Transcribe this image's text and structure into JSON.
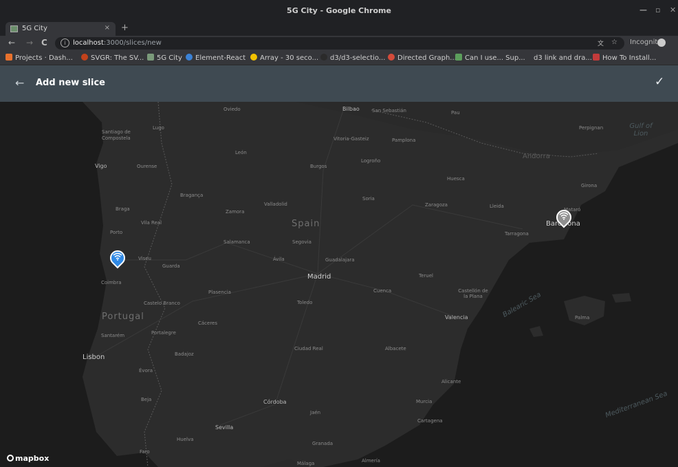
{
  "window": {
    "title": "5G City - Google Chrome"
  },
  "tab": {
    "label": "5G City",
    "close": "×",
    "new": "+"
  },
  "toolbar": {
    "url_host": "localhost",
    "url_path": ":3000/slices/new",
    "incognito": "Incognito",
    "back": "←",
    "forward": "→",
    "reload": "C"
  },
  "bookmarks": [
    {
      "label": "Projects · Dash...",
      "color": "#e8712d"
    },
    {
      "label": "SVGR: The SV...",
      "color": "#c2421b"
    },
    {
      "label": "5G City",
      "color": "#7a9a7a"
    },
    {
      "label": "Element-React",
      "color": "#3b82d6"
    },
    {
      "label": "Array - 30 seco...",
      "color": "#f2c200"
    },
    {
      "label": "d3/d3-selectio...",
      "color": "#2b2b2b"
    },
    {
      "label": "Directed Graph...",
      "color": "#d44b3a"
    },
    {
      "label": "Can I use... Sup...",
      "color": "#5c9e5c"
    },
    {
      "label": "d3 link and dra...",
      "color": "#888888"
    },
    {
      "label": "How To Install...",
      "color": "#c23b3b"
    }
  ],
  "appbar": {
    "back": "←",
    "title": "Add new slice",
    "confirm": "✓"
  },
  "map": {
    "country_labels": [
      "Spain",
      "Portugal"
    ],
    "sea_labels": [
      "Balearic Sea",
      "Mediterranean Sea",
      "Gulf of Lion"
    ],
    "cities": [
      "Oviedo",
      "Bilbao",
      "San Sebastián",
      "Pau",
      "Santiago de Compostela",
      "Lugo",
      "Vitoria-Gasteiz",
      "Pamplona",
      "Perpignan",
      "León",
      "Andorra",
      "Logroño",
      "Vigo",
      "Ourense",
      "Burgos",
      "Huesca",
      "Girona",
      "Bragança",
      "Soria",
      "Braga",
      "Valladolid",
      "Zaragoza",
      "Lleida",
      "Zamora",
      "Mataró",
      "Vila Real",
      "Barcelona",
      "Porto",
      "Tarragona",
      "Salamanca",
      "Segovia",
      "Viseu",
      "Ávila",
      "Guadalajara",
      "Guarda",
      "Madrid",
      "Teruel",
      "Coimbra",
      "Plasencia",
      "Cuenca",
      "Castellón de la Plana",
      "Toledo",
      "Castelo Branco",
      "Valencia",
      "Palma",
      "Cáceres",
      "Santarém",
      "Portalegre",
      "Badajoz",
      "Ciudad Real",
      "Albacete",
      "Lisbon",
      "Évora",
      "Alicante",
      "Beja",
      "Córdoba",
      "Murcia",
      "Jaén",
      "Cartagena",
      "Sevilla",
      "Granada",
      "Huelva",
      "Faro",
      "Almería",
      "Málaga"
    ],
    "attribution": "mapbox"
  }
}
